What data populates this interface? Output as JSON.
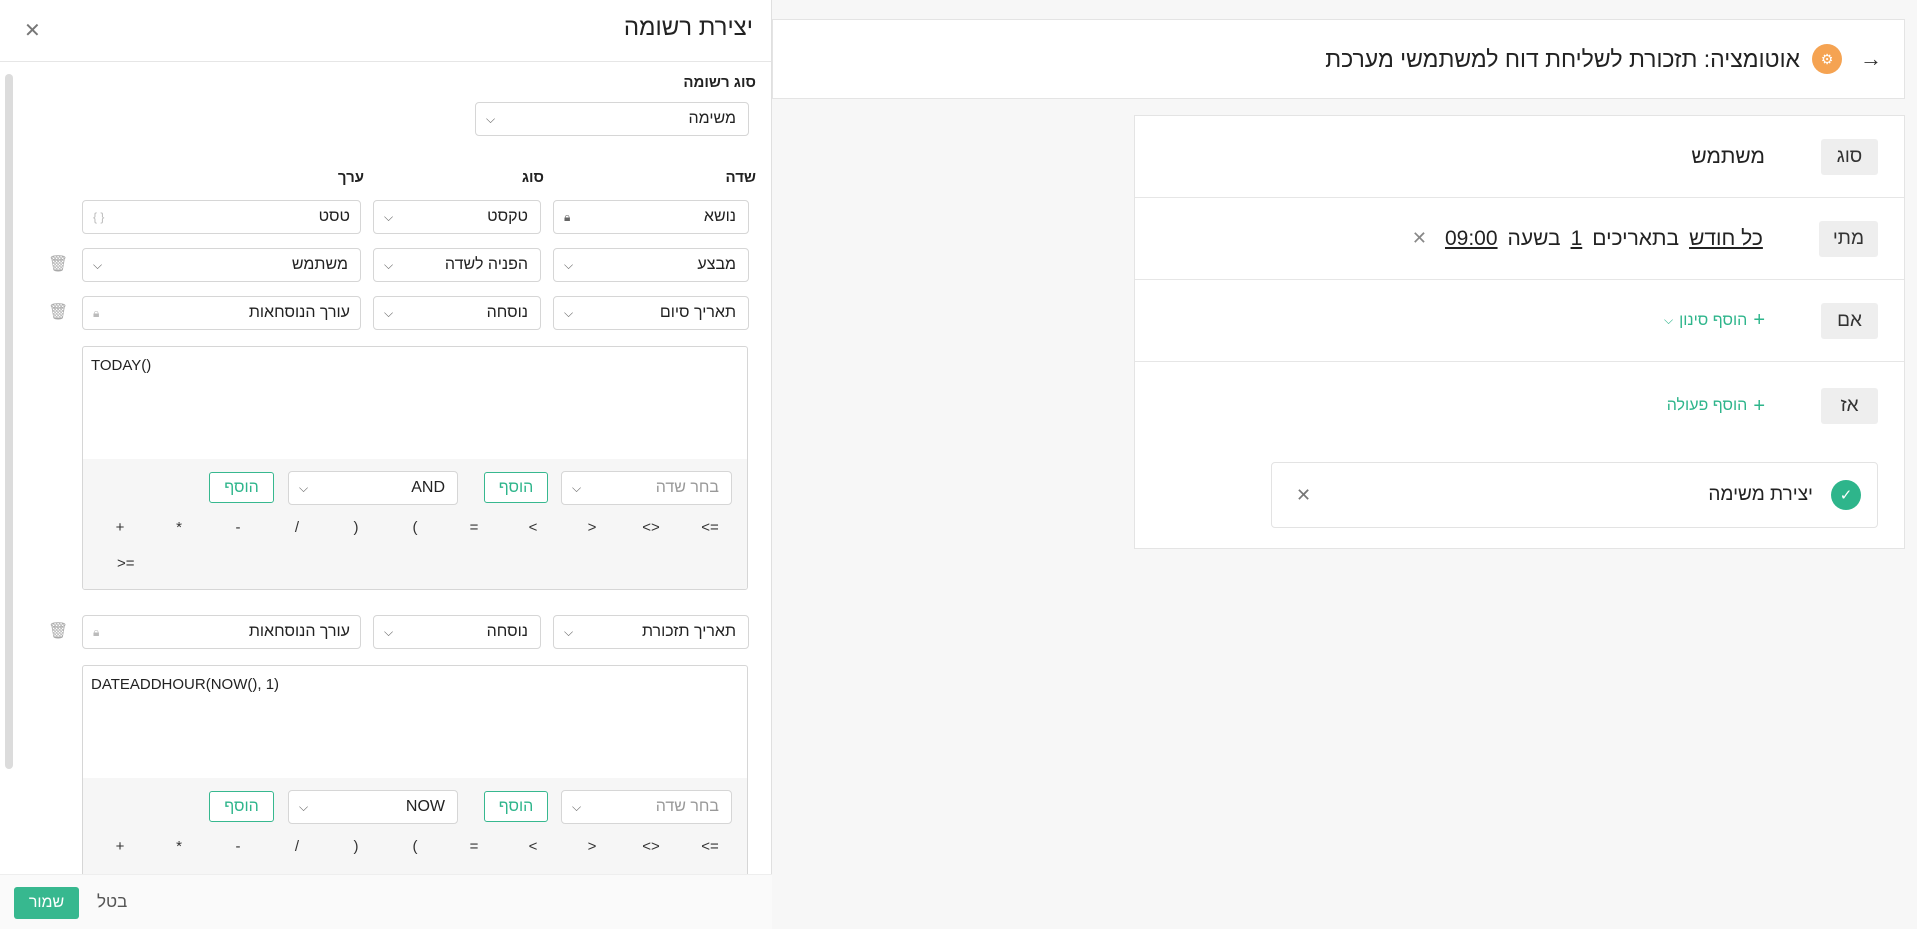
{
  "automation": {
    "title": "אוטומציה: תזכורת לשליחת דוח למשתמשי מערכת",
    "rules": {
      "type_tag": "סוג",
      "type_value": "משתמש",
      "when_tag": "מתי",
      "when_parts": [
        "כל חודש",
        "בתאריכים",
        "1",
        "בשעה",
        "09:00"
      ],
      "if_tag": "אם",
      "add_filter": "הוסף סינון",
      "then_tag": "אז",
      "add_action": "הוסף פעולה",
      "action_label": "יצירת משימה"
    }
  },
  "panel": {
    "title": "יצירת רשומה",
    "record_type_label": "סוג רשומה",
    "record_type_value": "משימה",
    "col_field": "שדה",
    "col_type": "סוג",
    "col_value": "ערך",
    "rows": [
      {
        "field": "נושא",
        "type": "טקסט",
        "value": "טסט"
      },
      {
        "field": "מבצע",
        "type": "הפניה לשדה",
        "value": "משתמש"
      },
      {
        "field": "תאריך סיום",
        "type": "נוסחה",
        "value": "עורך הנוסחאות"
      },
      {
        "field": "תאריך תזכורת",
        "type": "נוסחה",
        "value": "עורך הנוסחאות"
      }
    ],
    "formula1": {
      "code": "TODAY()",
      "field_placeholder": "בחר שדה",
      "add": "הוסף",
      "func": "AND",
      "add2": "הוסף"
    },
    "formula2": {
      "code": "DATEADDHOUR(NOW(), 1)",
      "field_placeholder": "בחר שדה",
      "add": "הוסף",
      "func": "NOW",
      "add2": "הוסף"
    },
    "operators": [
      "<=",
      "<>",
      ">",
      "<",
      "=",
      "(",
      ")",
      "/",
      "-",
      "*",
      "+"
    ],
    "operator_extra": ">=",
    "save": "שמור",
    "cancel": "בטל"
  }
}
